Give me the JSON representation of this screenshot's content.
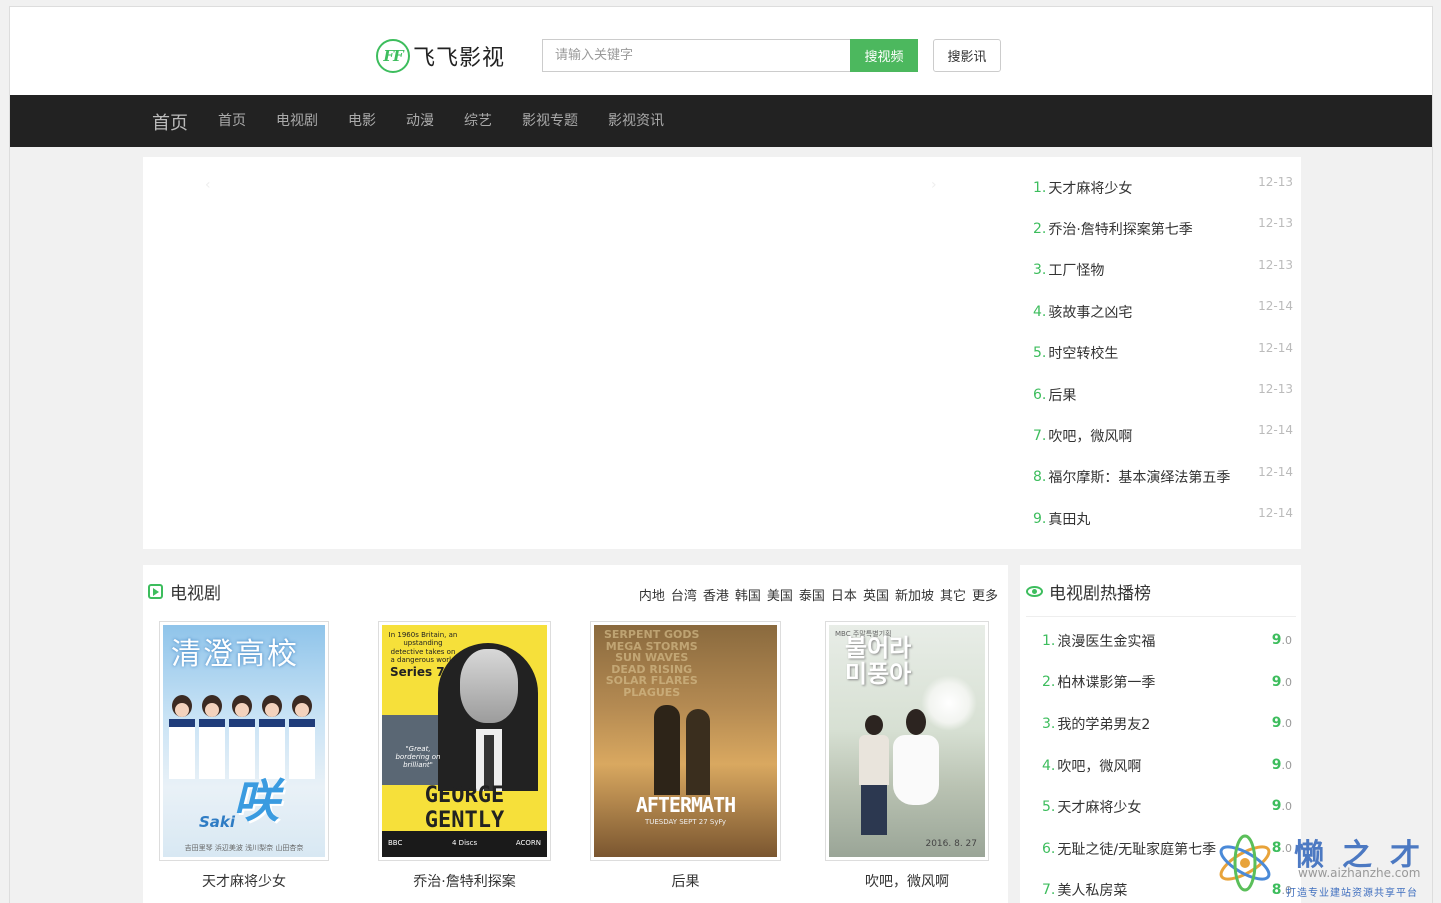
{
  "header": {
    "logo_mark": "FF",
    "site_name": "飞飞影视",
    "search_placeholder": "请输入关键字",
    "search_video_label": "搜视频",
    "search_news_label": "搜影讯"
  },
  "nav": {
    "brand": "首页",
    "items": [
      "首页",
      "电视剧",
      "电影",
      "动漫",
      "综艺",
      "影视专题",
      "影视资讯"
    ]
  },
  "slider": {
    "prev": "‹",
    "next": "›"
  },
  "latest": [
    {
      "num": "1.",
      "title": "天才麻将少女",
      "date": "12-13"
    },
    {
      "num": "2.",
      "title": "乔治·詹特利探案第七季",
      "date": "12-13"
    },
    {
      "num": "3.",
      "title": "工厂怪物",
      "date": "12-13"
    },
    {
      "num": "4.",
      "title": "骇故事之凶宅",
      "date": "12-14"
    },
    {
      "num": "5.",
      "title": "时空转校生",
      "date": "12-14"
    },
    {
      "num": "6.",
      "title": "后果",
      "date": "12-13"
    },
    {
      "num": "7.",
      "title": "吹吧，微风啊",
      "date": "12-14"
    },
    {
      "num": "8.",
      "title": "福尔摩斯：基本演绎法第五季",
      "date": "12-14"
    },
    {
      "num": "9.",
      "title": "真田丸",
      "date": "12-14"
    }
  ],
  "tv_section": {
    "title": "电视剧",
    "regions": [
      "内地",
      "台湾",
      "香港",
      "韩国",
      "美国",
      "泰国",
      "日本",
      "英国",
      "新加坡",
      "其它",
      "更多"
    ],
    "movies": [
      {
        "title": "天才麻将少女",
        "poster_title": "清澄高校",
        "poster_logo": "咲",
        "poster_logo_sub": "Saki",
        "poster_credits": "吉田里琴 浜辺美波 浅川梨奈 山田杏奈"
      },
      {
        "title": "乔治·詹特利探案",
        "poster_tagline": "In 1960s Britain, an upstanding detective takes on a dangerous world",
        "poster_series": "Series 7",
        "poster_quote": "\"Great, bordering on brilliant\"",
        "poster_name": "GEORGE GENTLY",
        "poster_foot_left": "BBC",
        "poster_foot_mid": "4 Discs",
        "poster_foot_right": "ACORN"
      },
      {
        "title": "后果",
        "poster_words": "SERPENT GODS\nMEGA STORMS\nSUN WAVES\nDEAD RISING\nSOLAR FLARES\nPLAGUES",
        "poster_name": "AFTERMATH",
        "poster_sub": "TUESDAY SEPT 27  SyFy"
      },
      {
        "title": "吹吧，微风啊",
        "poster_mbc": "MBC 주말특별기획",
        "poster_korean": "불어라\n미풍아",
        "poster_date": "2016. 8. 27"
      }
    ]
  },
  "hot_section": {
    "title": "电视剧热播榜",
    "items": [
      {
        "num": "1.",
        "name": "浪漫医生金实福",
        "score": "9",
        "decimal": ".0"
      },
      {
        "num": "2.",
        "name": "柏林谍影第一季",
        "score": "9",
        "decimal": ".0"
      },
      {
        "num": "3.",
        "name": "我的学弟男友2",
        "score": "9",
        "decimal": ".0"
      },
      {
        "num": "4.",
        "name": "吹吧，微风啊",
        "score": "9",
        "decimal": ".0"
      },
      {
        "num": "5.",
        "name": "天才麻将少女",
        "score": "9",
        "decimal": ".0"
      },
      {
        "num": "6.",
        "name": "无耻之徒/无耻家庭第七季",
        "score": "8",
        "decimal": ".0"
      },
      {
        "num": "7.",
        "name": "美人私房菜",
        "score": "8",
        "decimal": ".0"
      }
    ]
  },
  "watermark": {
    "text": "懒之才",
    "url": "www.aizhanzhe.com",
    "sub": "打造专业建站资源共享平台"
  },
  "colors": {
    "accent": "#3dbd5d",
    "nav_bg": "#222222",
    "page_bg": "#f1f1f1"
  }
}
